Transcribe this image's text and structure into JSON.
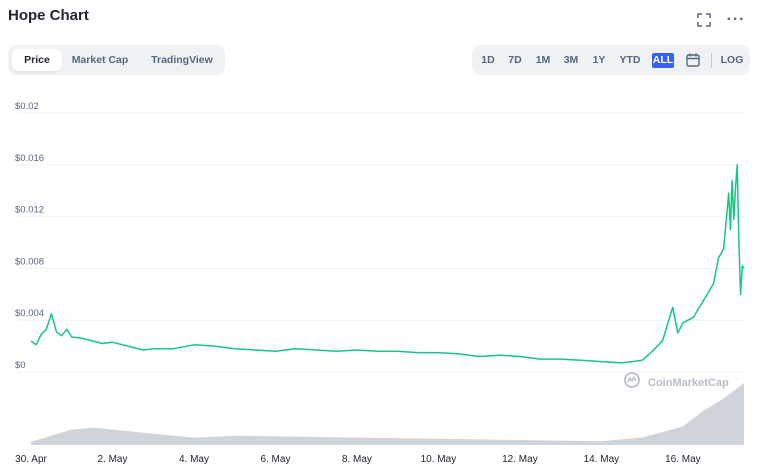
{
  "header": {
    "title": "Hope Chart",
    "expand_icon": "expand-icon",
    "more_icon": "more-icon",
    "more_glyph": "···"
  },
  "tabs": [
    {
      "label": "Price",
      "active": true
    },
    {
      "label": "Market Cap",
      "active": false
    },
    {
      "label": "TradingView",
      "active": false
    }
  ],
  "ranges": [
    {
      "label": "1D",
      "active": false
    },
    {
      "label": "7D",
      "active": false
    },
    {
      "label": "1M",
      "active": false
    },
    {
      "label": "3M",
      "active": false
    },
    {
      "label": "1Y",
      "active": false
    },
    {
      "label": "YTD",
      "active": false
    },
    {
      "label": "ALL",
      "active": true
    }
  ],
  "calendar_icon": "calendar-icon",
  "log_label": "LOG",
  "watermark": "CoinMarketCap",
  "colors": {
    "line": "#16c784",
    "volume": "#c7ccd4",
    "accent": "#3861fb"
  },
  "chart_data": {
    "type": "line",
    "title": "Hope Chart",
    "x_unit": "date",
    "y_unit": "USD",
    "ylim": [
      0,
      0.02
    ],
    "xlim": [
      "2021-04-30",
      "2021-05-17T12:00"
    ],
    "y_ticks": [
      "$0",
      "$0.004",
      "$0.008",
      "$0.012",
      "$0.016",
      "$0.02"
    ],
    "y_tick_values": [
      0,
      0.004,
      0.008,
      0.012,
      0.016,
      0.02
    ],
    "x_ticks": [
      "30. Apr",
      "2. May",
      "4. May",
      "6. May",
      "8. May",
      "10. May",
      "12. May",
      "14. May",
      "16. May"
    ],
    "x_tick_dates": [
      "2021-04-30",
      "2021-05-02",
      "2021-05-04",
      "2021-05-06",
      "2021-05-08",
      "2021-05-10",
      "2021-05-12",
      "2021-05-14",
      "2021-05-16"
    ],
    "grid": true,
    "series": [
      {
        "points": [
          [
            "2021-04-30T00:00",
            0.0024
          ],
          [
            "2021-04-30T03:00",
            0.0021
          ],
          [
            "2021-04-30T06:00",
            0.0029
          ],
          [
            "2021-04-30T09:00",
            0.0033
          ],
          [
            "2021-04-30T12:00",
            0.0045
          ],
          [
            "2021-04-30T15:00",
            0.0031
          ],
          [
            "2021-04-30T18:00",
            0.0028
          ],
          [
            "2021-04-30T21:00",
            0.0033
          ],
          [
            "2021-05-01T00:00",
            0.0027
          ],
          [
            "2021-05-01T06:00",
            0.0026
          ],
          [
            "2021-05-01T12:00",
            0.0024
          ],
          [
            "2021-05-01T18:00",
            0.0022
          ],
          [
            "2021-05-02T00:00",
            0.0023
          ],
          [
            "2021-05-02T06:00",
            0.0021
          ],
          [
            "2021-05-02T12:00",
            0.0019
          ],
          [
            "2021-05-02T18:00",
            0.0017
          ],
          [
            "2021-05-03T00:00",
            0.0018
          ],
          [
            "2021-05-03T12:00",
            0.0018
          ],
          [
            "2021-05-04T00:00",
            0.0021
          ],
          [
            "2021-05-04T12:00",
            0.002
          ],
          [
            "2021-05-05T00:00",
            0.0018
          ],
          [
            "2021-05-05T12:00",
            0.0017
          ],
          [
            "2021-05-06T00:00",
            0.0016
          ],
          [
            "2021-05-06T12:00",
            0.0018
          ],
          [
            "2021-05-07T00:00",
            0.0017
          ],
          [
            "2021-05-07T12:00",
            0.0016
          ],
          [
            "2021-05-08T00:00",
            0.0017
          ],
          [
            "2021-05-08T12:00",
            0.0016
          ],
          [
            "2021-05-09T00:00",
            0.0016
          ],
          [
            "2021-05-09T12:00",
            0.0015
          ],
          [
            "2021-05-10T00:00",
            0.0015
          ],
          [
            "2021-05-10T12:00",
            0.0014
          ],
          [
            "2021-05-11T00:00",
            0.0012
          ],
          [
            "2021-05-11T12:00",
            0.0013
          ],
          [
            "2021-05-12T00:00",
            0.0012
          ],
          [
            "2021-05-12T12:00",
            0.001
          ],
          [
            "2021-05-13T00:00",
            0.001
          ],
          [
            "2021-05-13T12:00",
            0.0009
          ],
          [
            "2021-05-14T00:00",
            0.0008
          ],
          [
            "2021-05-14T12:00",
            0.0007
          ],
          [
            "2021-05-15T00:00",
            0.0009
          ],
          [
            "2021-05-15T06:00",
            0.0016
          ],
          [
            "2021-05-15T12:00",
            0.0024
          ],
          [
            "2021-05-15T18:00",
            0.005
          ],
          [
            "2021-05-15T21:00",
            0.003
          ],
          [
            "2021-05-16T00:00",
            0.0038
          ],
          [
            "2021-05-16T06:00",
            0.0042
          ],
          [
            "2021-05-16T12:00",
            0.0055
          ],
          [
            "2021-05-16T18:00",
            0.0068
          ],
          [
            "2021-05-16T21:00",
            0.0088
          ],
          [
            "2021-05-17T00:00",
            0.0095
          ],
          [
            "2021-05-17T03:00",
            0.0138
          ],
          [
            "2021-05-17T04:00",
            0.011
          ],
          [
            "2021-05-17T05:00",
            0.0148
          ],
          [
            "2021-05-17T06:00",
            0.0118
          ],
          [
            "2021-05-17T07:00",
            0.0142
          ],
          [
            "2021-05-17T08:00",
            0.016
          ],
          [
            "2021-05-17T09:00",
            0.01
          ],
          [
            "2021-05-17T10:00",
            0.006
          ],
          [
            "2021-05-17T11:00",
            0.0082
          ],
          [
            "2021-05-17T12:00",
            0.008
          ]
        ]
      }
    ],
    "volume_relative": [
      [
        "2021-04-30T00:00",
        0.05
      ],
      [
        "2021-05-01T00:00",
        0.25
      ],
      [
        "2021-05-01T12:00",
        0.28
      ],
      [
        "2021-05-02T00:00",
        0.25
      ],
      [
        "2021-05-03T00:00",
        0.18
      ],
      [
        "2021-05-04T00:00",
        0.12
      ],
      [
        "2021-05-05T00:00",
        0.15
      ],
      [
        "2021-05-06T00:00",
        0.14
      ],
      [
        "2021-05-08T00:00",
        0.12
      ],
      [
        "2021-05-10T00:00",
        0.1
      ],
      [
        "2021-05-12T00:00",
        0.08
      ],
      [
        "2021-05-14T00:00",
        0.06
      ],
      [
        "2021-05-15T00:00",
        0.12
      ],
      [
        "2021-05-16T00:00",
        0.3
      ],
      [
        "2021-05-16T12:00",
        0.55
      ],
      [
        "2021-05-17T00:00",
        0.75
      ],
      [
        "2021-05-17T12:00",
        1.0
      ]
    ]
  }
}
